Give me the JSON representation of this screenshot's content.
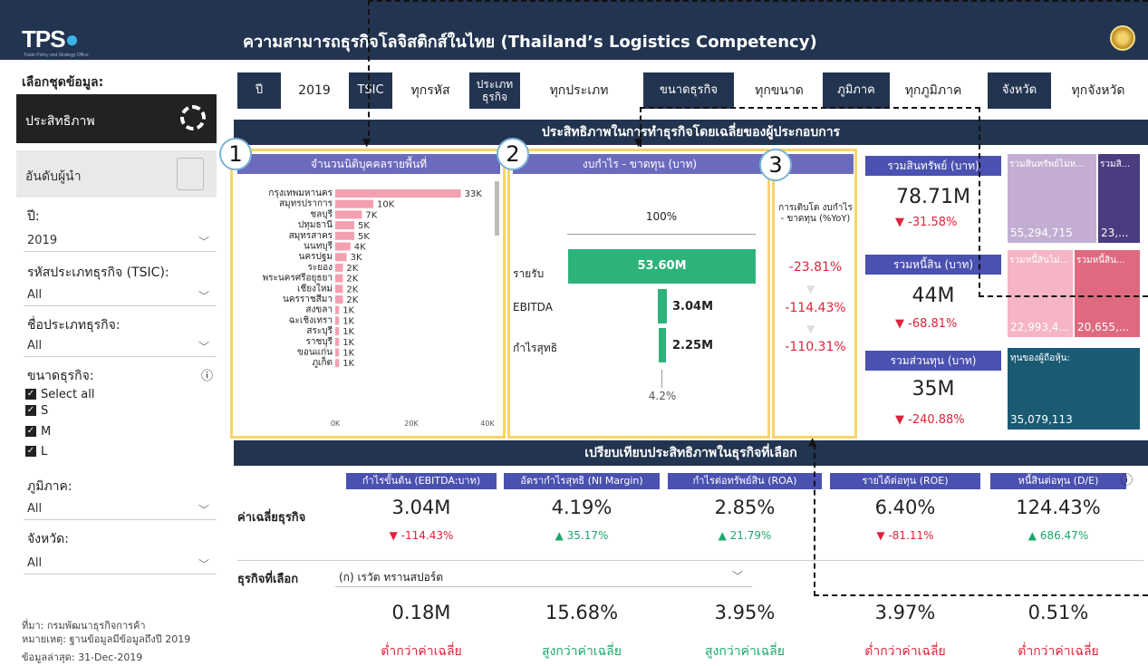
{
  "header": {
    "logo": "TPS",
    "logo_sub": "Trade Policy and Strategy Office",
    "title": "ความสามารถธุรกิจโลจิสติกส์ในไทย (Thailand’s Logistics Competency)"
  },
  "sidebar": {
    "heading": "เลือกชุดข้อมูล:",
    "nav_efficiency": "ประสิทธิภาพ",
    "nav_ranking": "อันดับผู้นำ",
    "year_label": "ปี:",
    "year_value": "2019",
    "tsic_label": "รหัสประเภทธุรกิจ (TSIC):",
    "tsic_value": "All",
    "type_label": "ชื่อประเภทธุรกิจ:",
    "type_value": "All",
    "size_label": "ขนาดธุรกิจ:",
    "size_options": [
      "Select all",
      "S",
      "M",
      "L"
    ],
    "region_label": "ภูมิภาค:",
    "region_value": "All",
    "province_label": "จังหวัด:",
    "province_value": "All",
    "source": "ที่มา: กรมพัฒนาธุรกิจการค้า",
    "note": "หมายเหตุ: ฐานข้อมูลมีข้อมูลถึงปี 2019",
    "updated": "ข้อมูลล่าสุด: 31-Dec-2019"
  },
  "filters": [
    {
      "key": "ปี",
      "value": "2019"
    },
    {
      "key": "TSIC",
      "value": "ทุกรหัส"
    },
    {
      "key": "ประเภท ธุรกิจ",
      "value": "ทุกประเภท"
    },
    {
      "key": "ขนาดธุรกิจ",
      "value": "ทุกขนาด"
    },
    {
      "key": "ภูมิภาค",
      "value": "ทุกภูมิภาค"
    },
    {
      "key": "จังหวัด",
      "value": "ทุกจังหวัด"
    }
  ],
  "section1_title": "ประสิทธิภาพในการทำธุรกิจโดยเฉลี่ยของผู้ประกอบการ",
  "section2_title": "เปรียบเทียบประสิทธิภาพในธุรกิจที่เลือก",
  "callouts": [
    "1",
    "2",
    "3"
  ],
  "panel1": {
    "title": "จำนวนนิติบุคคลรายพื้นที่",
    "axis": [
      "0K",
      "20K",
      "40K"
    ]
  },
  "chart_data": {
    "type": "bar",
    "orientation": "horizontal",
    "categories": [
      "กรุงเทพมหานคร",
      "สมุทรปราการ",
      "ชลบุรี",
      "ปทุมธานี",
      "สมุทรสาคร",
      "นนทบุรี",
      "นครปฐม",
      "ระยอง",
      "พระนครศรีอยุธยา",
      "เชียงใหม่",
      "นครราชสีมา",
      "สงขลา",
      "ฉะเชิงเทรา",
      "สระบุรี",
      "ราชบุรี",
      "ขอนแก่น",
      "ภูเก็ต"
    ],
    "values": [
      33,
      10,
      7,
      5,
      5,
      4,
      3,
      2,
      2,
      2,
      2,
      1,
      1,
      1,
      1,
      1,
      1
    ],
    "labels": [
      "33K",
      "10K",
      "7K",
      "5K",
      "5K",
      "4K",
      "3K",
      "2K",
      "2K",
      "2K",
      "2K",
      "1K",
      "1K",
      "1K",
      "1K",
      "1K",
      "1K"
    ],
    "xlim": [
      0,
      40
    ],
    "color": "#f4a0b0"
  },
  "panel2": {
    "title": "งบกำไร - ขาดทุน (บาท)",
    "pct_top": "100%",
    "pct_bottom": "4.2%",
    "rows": [
      {
        "label": "รายรับ",
        "value": "53.60M"
      },
      {
        "label": "EBITDA",
        "value": "3.04M"
      },
      {
        "label": "กำไรสุทธิ",
        "value": "2.25M"
      }
    ]
  },
  "panel3": {
    "title": "การเติบโต งบกำไร - ขาดทุน (%YoY)",
    "values": [
      "-23.81%",
      "-114.43%",
      "-110.31%"
    ]
  },
  "kpis": [
    {
      "title": "รวมสินทรัพย์ (บาท)",
      "value": "78.71M",
      "delta": "▼ -31.58%"
    },
    {
      "title": "รวมหนี้สิน (บาท)",
      "value": "44M",
      "delta": "▼ -68.81%"
    },
    {
      "title": "รวมส่วนทุน (บาท)",
      "value": "35M",
      "delta": "▼ -240.88%"
    }
  ],
  "tiles": {
    "asset_a_label": "รวมสินทรัพย์ไม่ห...",
    "asset_a_value": "55,294,715",
    "asset_b_label": "รวมสิ...",
    "asset_b_value": "23,...",
    "debt_a_label": "รวมหนี้สินไม่...",
    "debt_a_value": "22,993,4...",
    "debt_b_label": "รวมหนี้สิน...",
    "debt_b_value": "20,655,...",
    "equity_label": "ทุนของผู้ถือหุ้น:",
    "equity_value": "35,079,113"
  },
  "compare": {
    "columns": [
      "กำไรขั้นต้น (EBITDA:บาท)",
      "อัตรากำไรสุทธิ (NI Margin)",
      "กำไรต่อทรัพย์สิน (ROA)",
      "รายได้ต่อทุน (ROE)",
      "หนี้สินต่อทุน (D/E)"
    ],
    "avg_label": "ค่าเฉลี่ยธุรกิจ",
    "avg_values": [
      "3.04M",
      "4.19%",
      "2.85%",
      "6.40%",
      "124.43%"
    ],
    "avg_deltas": [
      "▼ -114.43%",
      "▲ 35.17%",
      "▲ 21.79%",
      "▼ -81.11%",
      "▲ 686.47%"
    ],
    "sel_label": "ธุรกิจที่เลือก",
    "sel_company": "(ก) เรวัต ทรานสปอร์ต",
    "sel_values": [
      "0.18M",
      "15.68%",
      "3.95%",
      "3.97%",
      "0.51%"
    ],
    "sel_compare": [
      "ต่ำกว่าค่าเฉลี่ย",
      "สูงกว่าค่าเฉลี่ย",
      "สูงกว่าค่าเฉลี่ย",
      "ต่ำกว่าค่าเฉลี่ย",
      "ต่ำกว่าค่าเฉลี่ย"
    ]
  }
}
